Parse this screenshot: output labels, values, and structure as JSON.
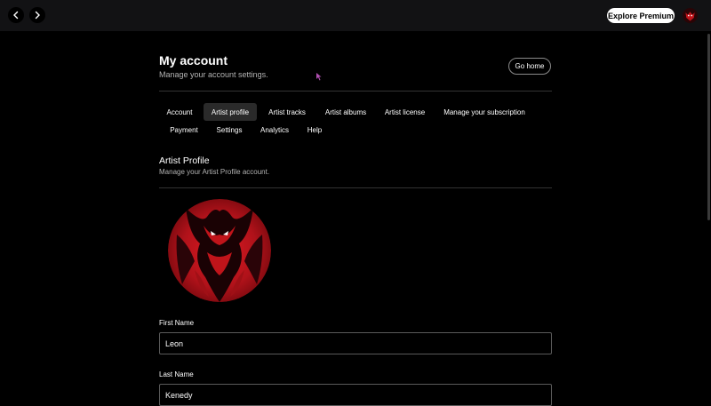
{
  "header": {
    "premium_label": "Explore Premium"
  },
  "page": {
    "title": "My account",
    "subtitle": "Manage your account settings.",
    "go_home_label": "Go home"
  },
  "tabs": [
    {
      "label": "Account"
    },
    {
      "label": "Artist profile"
    },
    {
      "label": "Artist tracks"
    },
    {
      "label": "Artist albums"
    },
    {
      "label": "Artist license"
    },
    {
      "label": "Manage your subscription"
    },
    {
      "label": "Payment"
    },
    {
      "label": "Settings"
    },
    {
      "label": "Analytics"
    },
    {
      "label": "Help"
    }
  ],
  "active_tab": "Artist profile",
  "section": {
    "title": "Artist Profile",
    "subtitle": "Manage your Artist Profile account."
  },
  "form": {
    "first_name_label": "First Name",
    "first_name_value": "Leon",
    "last_name_label": "Last Name",
    "last_name_value": "Kenedy"
  },
  "colors": {
    "background": "#000000",
    "topbar": "#121214",
    "accent_red": "#c0141a",
    "active_tab": "#2a2a2a"
  },
  "icons": {
    "back": "chevron-left-icon",
    "forward": "chevron-right-icon",
    "profile_art": "red-demon-artwork"
  }
}
